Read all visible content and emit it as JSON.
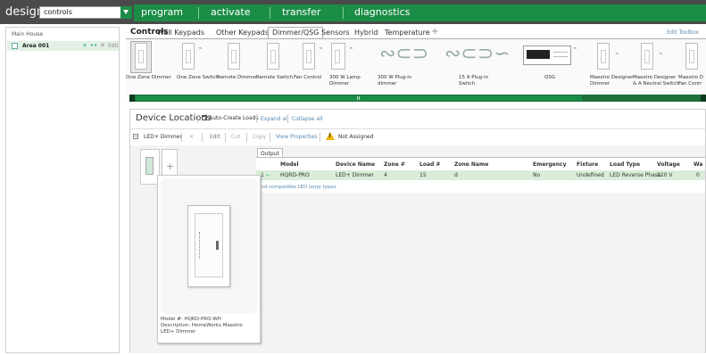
{
  "topbar": {
    "mode": "design",
    "selector_value": "controls",
    "nav": [
      "program",
      "activate",
      "transfer",
      "diagnostics"
    ]
  },
  "tree": {
    "root": "Main House",
    "area": "Area 001",
    "area_actions": [
      "+",
      "••",
      "✕"
    ],
    "area_edit": "Edit"
  },
  "controls": {
    "title": "Controls",
    "tabs": [
      "Wall Keypads",
      "Other Keypads",
      "Dimmer/QSG",
      "Sensors",
      "Hybrid",
      "Temperature"
    ],
    "active_tab": "Dimmer/QSG",
    "add_tab": "+",
    "edit_toolbox": "Edit Toolbox",
    "tools": [
      {
        "label": "One Zone Dimmer",
        "selected": true
      },
      {
        "label": "One Zone Switch"
      },
      {
        "label": "Remote Dimmer"
      },
      {
        "label": "Remote Switch"
      },
      {
        "label": "Fan Control"
      },
      {
        "label": "300 W Lamp\nDimmer"
      },
      {
        "label": "300 W Plug-in\ndimmer"
      },
      {
        "label": "15 A Plug-in\nSwitch"
      },
      {
        "label": "QSG"
      },
      {
        "label": "Maestro Designer\nDimmer"
      },
      {
        "label": "Maestro Designer\n& A Neutral Switch"
      },
      {
        "label": "Maestro D\nFan Contr"
      }
    ]
  },
  "devices": {
    "title": "Device Locations",
    "auto_create": "Auto-Create Loads",
    "expand_all": "Expand all",
    "collapse_all": "Collapse all",
    "toolbar": {
      "device": "LED+ Dimmer",
      "delete": "✕",
      "edit": "Edit",
      "cut": "Cut",
      "copy": "Copy",
      "view_properties": "View Properties",
      "warning": "Not Assigned"
    },
    "output_tab": "Output",
    "columns": [
      "Model",
      "Device Name",
      "Zone #",
      "Load #",
      "Zone Name",
      "Emergency",
      "Fixture",
      "Load Type",
      "Voltage",
      "Wa"
    ],
    "row": {
      "index": "1",
      "model": "HQRD-PRO",
      "device_name": "LED+ Dimmer",
      "zone": "4",
      "load": "15",
      "zone_name": "d",
      "emergency": "No",
      "fixture": "Undefined",
      "load_type": "LED Reverse Phase",
      "voltage": "120 V",
      "wattage": "0"
    },
    "compat_link": "Find compatible LED lamp types",
    "preview": {
      "model": "Model #: HQRD-PRO-WH",
      "description": "Description: HomeWorks Maestro LED+ Dimmer"
    }
  }
}
